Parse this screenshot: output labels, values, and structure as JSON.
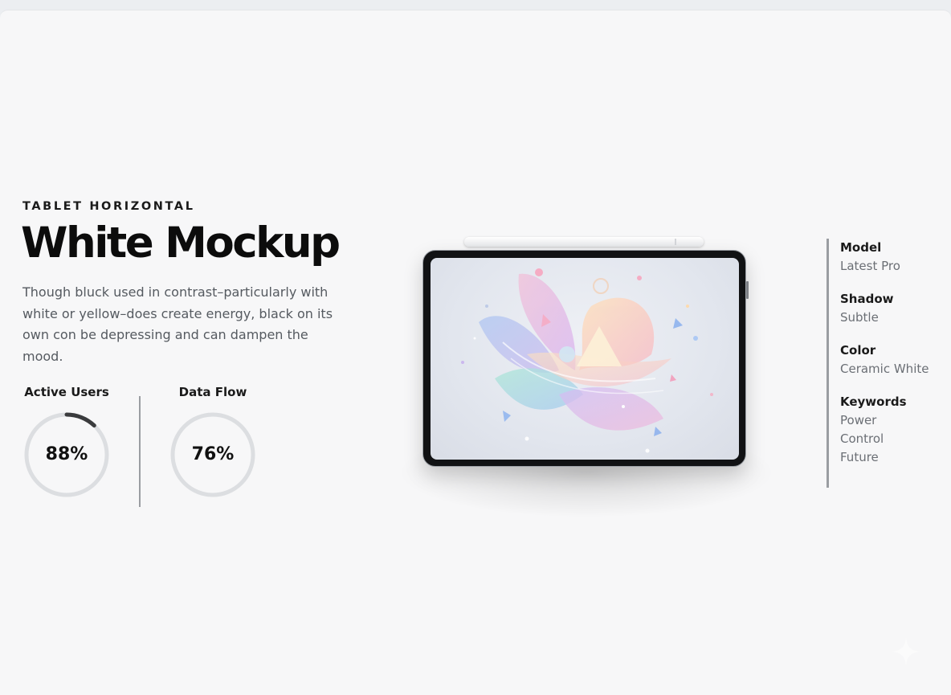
{
  "hero": {
    "eyebrow": "TABLET HORIZONTAL",
    "title": "White Mockup",
    "description": "Though bluck used in contrast–particularly with white or yellow–does create energy, black on its own con be depressing and can dampen the mood."
  },
  "stats": [
    {
      "label": "Active Users",
      "value_text": "88%",
      "progress": 0.12
    },
    {
      "label": "Data Flow",
      "value_text": "76%",
      "progress": 0
    }
  ],
  "specs": [
    {
      "title": "Model",
      "values": [
        "Latest Pro"
      ]
    },
    {
      "title": "Shadow",
      "values": [
        "Subtle"
      ]
    },
    {
      "title": "Color",
      "values": [
        "Ceramic White"
      ]
    },
    {
      "title": "Keywords",
      "values": [
        "Power",
        "Control",
        "Future"
      ]
    }
  ],
  "colors": {
    "background": "#f7f7f8",
    "ring_track": "#dcdee1",
    "ring_progress": "#3a3b3d",
    "text_primary": "#0c0c0c",
    "text_secondary": "#555a60",
    "divider": "#9a9da2",
    "tablet_bezel": "#111214"
  },
  "icons": {
    "pencil": "stylus-pencil-icon",
    "tablet": "tablet-device-icon",
    "sparkle": "sparkle-icon"
  }
}
